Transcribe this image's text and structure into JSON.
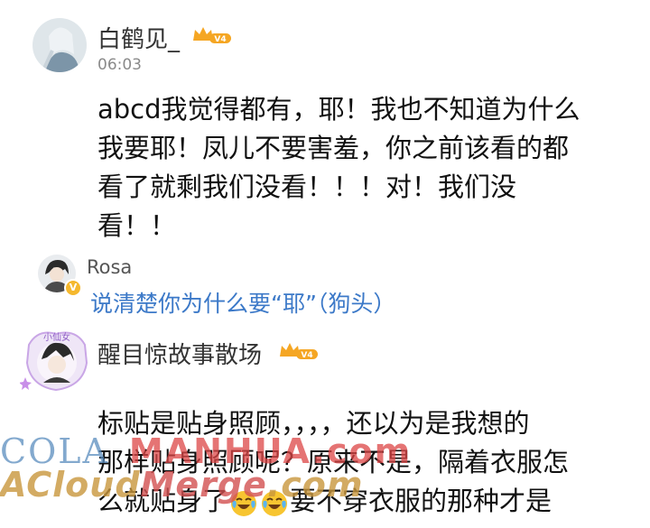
{
  "comments": [
    {
      "user": "白鹤见_",
      "level_badge": "V4",
      "time": "06:03",
      "lines": [
        "abcd我觉得都有，耶！我也不知道为什么",
        "我要耶！凤儿不要害羞，你之前该看的都",
        "看了就剩我们没看！！！对！我们没",
        "看！！"
      ],
      "reply": {
        "user": "Rosa",
        "verified_badge": "V",
        "text": "说清楚你为什么要“耶”（狗头）"
      }
    },
    {
      "user": "醒目惊故事散场",
      "level_badge": "V4",
      "lines": [
        "标贴是贴身照顾，，，，还以为是我想的",
        "那样贴身照顾呢？原来不是，隔着衣服怎",
        "么就贴身了",
        "要不穿衣服的那种才是"
      ],
      "emoji": [
        "laughing-crying-emoji",
        "laughing-crying-emoji"
      ]
    }
  ],
  "watermark": {
    "line1_a": "COLA",
    "line1_b": "MANHUA",
    "line1_c": ".com",
    "line2_a": "ACloud",
    "line2_b": "Merge",
    "line2_c": ".com"
  },
  "colors": {
    "reply_link": "#3c79c8",
    "badge_orange": "#f5a623",
    "username": "#333333",
    "timestamp": "#8a8a8a"
  }
}
